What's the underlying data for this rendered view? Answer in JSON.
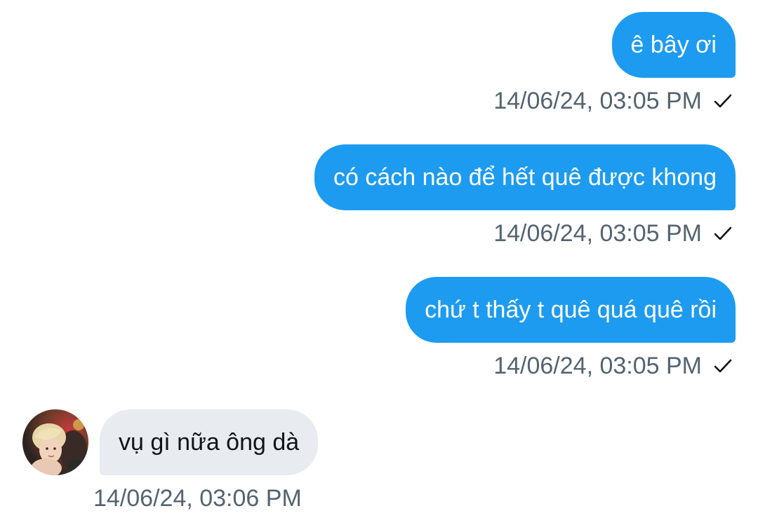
{
  "messages": [
    {
      "direction": "outgoing",
      "text": "ê bây ơi",
      "timestamp": "14/06/24, 03:05 PM",
      "status_icon": "check-icon"
    },
    {
      "direction": "outgoing",
      "text": "có cách nào để hết quê được khong",
      "timestamp": "14/06/24, 03:05 PM",
      "status_icon": "check-icon"
    },
    {
      "direction": "outgoing",
      "text": "chứ t thấy t quê quá quê rồi",
      "timestamp": "14/06/24, 03:05 PM",
      "status_icon": "check-icon"
    },
    {
      "direction": "incoming",
      "text": "vụ gì nữa ông dà",
      "timestamp": "14/06/24, 03:06 PM"
    }
  ],
  "colors": {
    "outgoing_bubble": "#1d9bf0",
    "incoming_bubble": "#e8ebef",
    "timestamp_text": "#536471"
  }
}
